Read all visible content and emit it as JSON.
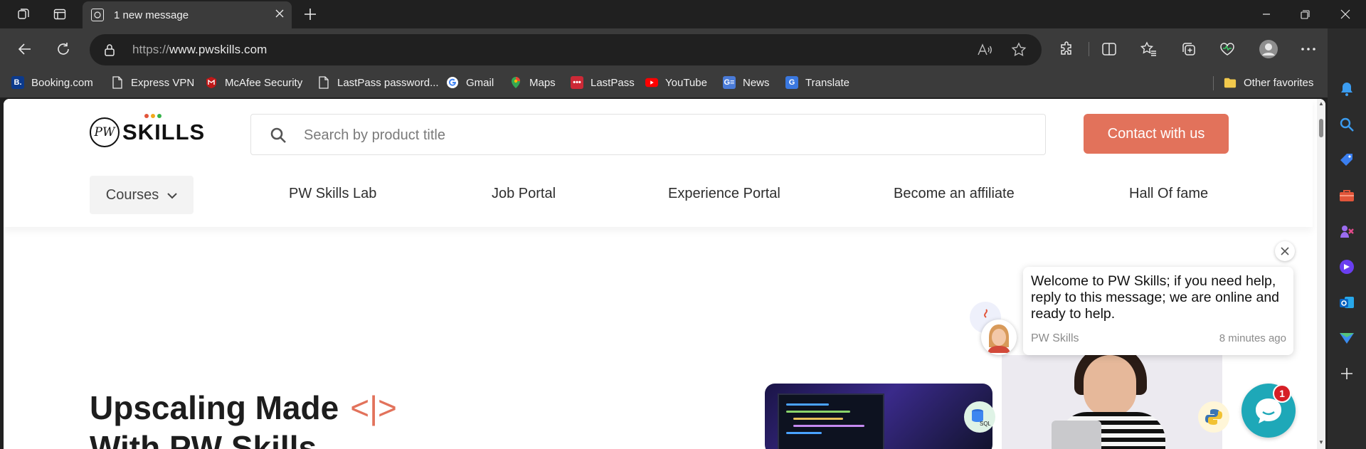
{
  "browser": {
    "tab": {
      "title": "1 new message"
    },
    "address": {
      "scheme": "https://",
      "host": "www.pwskills.com"
    },
    "bookmarks": [
      {
        "label": "Booking.com",
        "icon": "booking-icon"
      },
      {
        "label": "Express VPN",
        "icon": "page-icon"
      },
      {
        "label": "McAfee Security",
        "icon": "mcafee-icon"
      },
      {
        "label": "LastPass password...",
        "icon": "page-icon"
      },
      {
        "label": "Gmail",
        "icon": "google-icon"
      },
      {
        "label": "Maps",
        "icon": "maps-icon"
      },
      {
        "label": "LastPass",
        "icon": "lastpass-icon"
      },
      {
        "label": "YouTube",
        "icon": "youtube-icon"
      },
      {
        "label": "News",
        "icon": "news-icon"
      },
      {
        "label": "Translate",
        "icon": "translate-icon"
      }
    ],
    "other_favorites": "Other favorites"
  },
  "site": {
    "logo_text": "SKILLS",
    "logo_mark": "PW",
    "search": {
      "placeholder": "Search by product title"
    },
    "contact_label": "Contact with us",
    "nav": {
      "courses": "Courses",
      "links": [
        "PW Skills Lab",
        "Job Portal",
        "Experience Portal",
        "Become an affiliate",
        "Hall Of fame"
      ]
    },
    "hero": {
      "line1": "Upscaling Made",
      "code_symbol": "<|>",
      "line2": "With PW Skills"
    },
    "badges": {
      "sql": "SQL"
    }
  },
  "chat": {
    "message": "Welcome to PW Skills; if you need help, reply to this message; we are online and ready to help.",
    "from": "PW Skills",
    "time": "8 minutes ago",
    "unread_count": "1"
  },
  "colors": {
    "accent": "#e2725b",
    "chat": "#1ea8b8",
    "badge": "#d61f26"
  }
}
